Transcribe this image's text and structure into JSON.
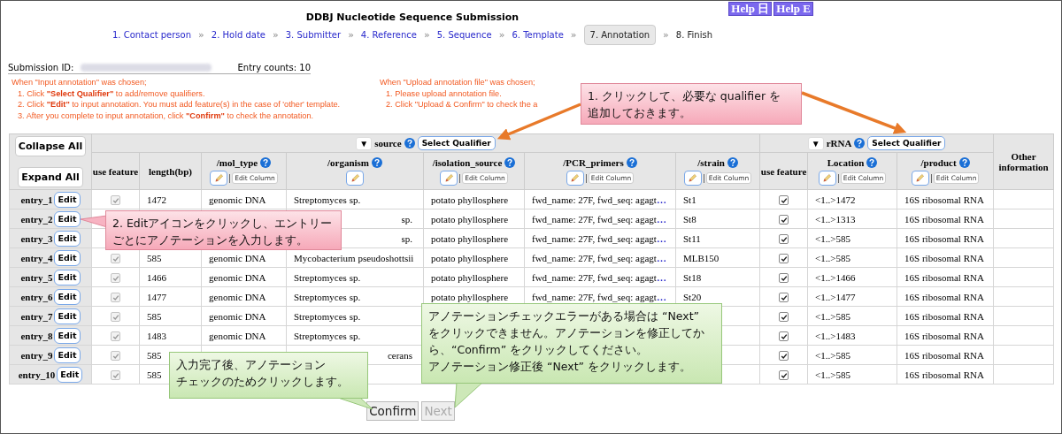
{
  "header": {
    "title": "DDBJ Nucleotide Sequence Submission",
    "help_buttons": [
      "Help 日",
      "Help E"
    ]
  },
  "steps": [
    {
      "label": "1. Contact person",
      "kind": "link",
      "selected": false,
      "separator": "»"
    },
    {
      "label": "2. Hold date",
      "kind": "link",
      "selected": false,
      "separator": "»"
    },
    {
      "label": "3. Submitter",
      "kind": "link",
      "selected": false,
      "separator": "»"
    },
    {
      "label": "4. Reference",
      "kind": "link",
      "selected": false,
      "separator": "»"
    },
    {
      "label": "5. Sequence",
      "kind": "link",
      "selected": false,
      "separator": "»"
    },
    {
      "label": "6. Template",
      "kind": "link",
      "selected": false,
      "separator": "»"
    },
    {
      "label": "7. Annotation",
      "kind": "text",
      "selected": true,
      "separator": "»"
    },
    {
      "label": "8. Finish",
      "kind": "text",
      "selected": false
    }
  ],
  "submission": {
    "id_label": "Submission ID:",
    "entry_counts": "Entry counts: 10"
  },
  "instructions": [
    {
      "heading": "When \"Input annotation\" was chosen;",
      "items": [
        "1. Click **\"Select Qualifier\"** to add/remove qualifiers.",
        "2. Click **\"Edit\"** to input annotation. You must add feature(s) in the case of 'other' template.",
        "3. After you complete to input annotation, click **\"Confirm\"** to check the annotation."
      ]
    },
    {
      "heading": "When \"Upload annotation file\" was chosen;",
      "items": [
        "1. Please upload annotation file.",
        "2. Click \"Upload & Confirm\" to check the a"
      ]
    }
  ],
  "table": {
    "collapse_button": "Collapse All",
    "expand_button": "Expand All",
    "other_header": "Other information",
    "groups": [
      {
        "toggle": "▼",
        "name": "source",
        "button": "Select Qualifier",
        "columns": [
          {
            "label": "use feature",
            "kind": "check"
          },
          {
            "label": "length(bp)",
            "kind": "text"
          },
          {
            "label": "/mol_type",
            "kind": "text",
            "help": true,
            "edit_icon": true,
            "edit_column": "Edit Column"
          },
          {
            "label": "/organism",
            "kind": "text",
            "help": true,
            "edit_icon": true
          },
          {
            "label": "/isolation_source",
            "kind": "text",
            "help": true,
            "edit_icon": true,
            "edit_column": "Edit Column"
          },
          {
            "label": "/PCR_primers",
            "kind": "primer",
            "help": true,
            "edit_icon": true,
            "edit_column": "Edit Column"
          },
          {
            "label": "/strain",
            "kind": "text",
            "help": true,
            "edit_icon": true,
            "edit_column": "Edit Column"
          }
        ]
      },
      {
        "toggle": "▼",
        "name": "rRNA",
        "button": "Select Qualifier",
        "columns": [
          {
            "label": "use feature",
            "kind": "check"
          },
          {
            "label": "Location",
            "kind": "text",
            "help": true,
            "edit_icon": true,
            "edit_column": "Edit Column"
          },
          {
            "label": "/product",
            "kind": "text",
            "help": true,
            "edit_icon": true,
            "edit_column": "Edit Column"
          }
        ]
      }
    ],
    "rows": [
      {
        "entry": "entry_1",
        "edit": "Edit",
        "cells": [
          {
            "checked": true,
            "disabled": true
          },
          "1472",
          "genomic DNA",
          "Streptomyces sp.",
          "potato phyllosphere",
          {
            "text": "fwd_name: 27F, fwd_seq: agagt",
            "more": "…"
          },
          "St1",
          {
            "checked": true,
            "disabled": false
          },
          "<1..>1472",
          "16S ribosomal RNA"
        ]
      },
      {
        "entry": "entry_2",
        "edit": "Edit",
        "cells": [
          null,
          null,
          null,
          {
            "text": "sp.",
            "clipped": true
          },
          "potato phyllosphere",
          {
            "text": "fwd_name: 27F, fwd_seq: agagt",
            "more": "…"
          },
          "St8",
          {
            "checked": true,
            "disabled": false
          },
          "<1..>1313",
          "16S ribosomal RNA"
        ]
      },
      {
        "entry": "entry_3",
        "edit": "Edit",
        "cells": [
          null,
          null,
          null,
          {
            "text": "sp.",
            "clipped": true
          },
          "potato phyllosphere",
          {
            "text": "fwd_name: 27F, fwd_seq: agagt",
            "more": "…"
          },
          "St11",
          {
            "checked": true,
            "disabled": false
          },
          "<1..>585",
          "16S ribosomal RNA"
        ]
      },
      {
        "entry": "entry_4",
        "edit": "Edit",
        "cells": [
          {
            "checked": true,
            "disabled": true
          },
          "585",
          "genomic DNA",
          "Mycobacterium pseudoshottsii",
          "potato phyllosphere",
          {
            "text": "fwd_name: 27F, fwd_seq: agagt",
            "more": "…"
          },
          "MLB150",
          {
            "checked": true,
            "disabled": false
          },
          "<1..>585",
          "16S ribosomal RNA"
        ]
      },
      {
        "entry": "entry_5",
        "edit": "Edit",
        "cells": [
          {
            "checked": true,
            "disabled": true
          },
          "1466",
          "genomic DNA",
          "Streptomyces sp.",
          "potato phyllosphere",
          {
            "text": "fwd_name: 27F, fwd_seq: agagt",
            "more": "…"
          },
          "St18",
          {
            "checked": true,
            "disabled": false
          },
          "<1..>1466",
          "16S ribosomal RNA"
        ]
      },
      {
        "entry": "entry_6",
        "edit": "Edit",
        "cells": [
          {
            "checked": true,
            "disabled": true
          },
          "1477",
          "genomic DNA",
          "Streptomyces sp.",
          "potato phyllosphere",
          {
            "text": "fwd_name: 27F, fwd_seq: agagt",
            "more": "…"
          },
          "St20",
          {
            "checked": true,
            "disabled": false
          },
          "<1..>1477",
          "16S ribosomal RNA"
        ]
      },
      {
        "entry": "entry_7",
        "edit": "Edit",
        "cells": [
          {
            "checked": true,
            "disabled": true
          },
          "585",
          "genomic DNA",
          "Streptomyces sp.",
          null,
          null,
          null,
          {
            "checked": true,
            "disabled": false
          },
          "<1..>585",
          "16S ribosomal RNA"
        ]
      },
      {
        "entry": "entry_8",
        "edit": "Edit",
        "cells": [
          {
            "checked": true,
            "disabled": true
          },
          "1483",
          "genomic DNA",
          "Streptomyces sp.",
          null,
          null,
          null,
          {
            "checked": true,
            "disabled": false
          },
          "<1..>1483",
          "16S ribosomal RNA"
        ]
      },
      {
        "entry": "entry_9",
        "edit": "Edit",
        "cells": [
          {
            "checked": true,
            "disabled": true
          },
          "585",
          null,
          {
            "text": "cerans",
            "clipped": true
          },
          null,
          null,
          null,
          {
            "checked": true,
            "disabled": false
          },
          "<1..>585",
          "16S ribosomal RNA"
        ]
      },
      {
        "entry": "entry_10",
        "edit": "Edit",
        "cells": [
          {
            "checked": true,
            "disabled": true
          },
          "585",
          null,
          null,
          null,
          null,
          null,
          {
            "checked": true,
            "disabled": false
          },
          "<1..>585",
          "16S ribosomal RNA"
        ]
      }
    ]
  },
  "actions": [
    {
      "label": "Confirm",
      "disabled": false
    },
    {
      "label": "Next",
      "disabled": true
    }
  ],
  "callouts": [
    {
      "kind": "pink",
      "lines": [
        "1. クリックして、必要な qualifier を",
        "追加しておきます。"
      ]
    },
    {
      "kind": "pink",
      "lines": [
        "2. Editアイコンをクリックし、エントリー",
        "ごとにアノテーションを入力します。"
      ]
    },
    {
      "kind": "green",
      "lines": [
        "入力完了後、アノテーション",
        "チェックのためクリックします。"
      ]
    },
    {
      "kind": "green",
      "lines": [
        "アノテーションチェックエラーがある場合は “Next”",
        "をクリックできません。アノテーションを修正してか",
        "ら、“Confirm” をクリックしてください。",
        "アノテーション修正後 “Next” をクリックします。"
      ]
    }
  ],
  "arrows": [
    {
      "kind": "orange"
    },
    {
      "kind": "orange"
    }
  ]
}
